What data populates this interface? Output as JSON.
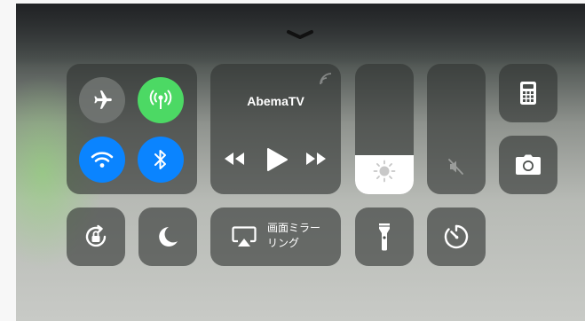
{
  "media": {
    "app_name": "AbemaTV"
  },
  "screen_mirroring": {
    "label_line1": "画面ミラー",
    "label_line2": "リング"
  },
  "brightness": {
    "level": 0.3
  },
  "volume": {
    "level": 0.0,
    "muted": true
  },
  "toggles": {
    "airplane": {
      "icon": "airplane-icon",
      "active": false
    },
    "cellular": {
      "icon": "cellular-icon",
      "active": true,
      "color": "#4cd964"
    },
    "wifi": {
      "icon": "wifi-icon",
      "active": true,
      "color": "#0a84ff"
    },
    "bluetooth": {
      "icon": "bluetooth-icon",
      "active": true,
      "color": "#0a84ff"
    }
  },
  "colors": {
    "tile": "#3a3e3c",
    "active_green": "#4cd964",
    "active_blue": "#0a84ff"
  }
}
